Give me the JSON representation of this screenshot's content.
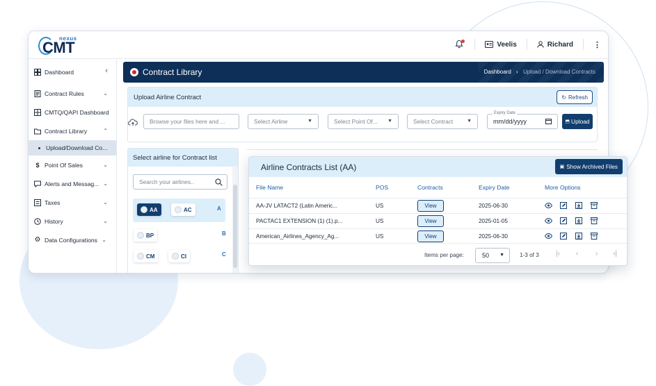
{
  "app": {
    "logo_main": "CMT",
    "logo_sub": "nexus"
  },
  "topbar": {
    "org": "Veelis",
    "user": "Richard"
  },
  "sidebar": {
    "items": [
      {
        "label": "Dashboard",
        "icon": "dashboard-icon"
      },
      {
        "label": "Contract Rules",
        "icon": "contract-rules-icon"
      },
      {
        "label": "CMTQ/QAPI Dashboard",
        "icon": "grid-icon"
      },
      {
        "label": "Contract Library",
        "icon": "folder-icon"
      },
      {
        "label": "Upload/Download Co...",
        "icon": "bullet"
      },
      {
        "label": "Point Of Sales",
        "icon": "dollar-icon"
      },
      {
        "label": "Alerts and Messag...",
        "icon": "message-icon"
      },
      {
        "label": "Taxes",
        "icon": "tax-icon"
      },
      {
        "label": "History",
        "icon": "history-icon"
      },
      {
        "label": "Data Configurations",
        "icon": "gear-icon"
      }
    ]
  },
  "header": {
    "title": "Contract Library",
    "crumb_home": "Dashboard",
    "crumb_sep": "›",
    "crumb_current": "Upload / Download Contracts"
  },
  "upload": {
    "title": "Upload Airline Contract",
    "refresh_label": "Refresh",
    "browse_placeholder": "Browse your files here and ...",
    "airline_placeholder": "Select Airline",
    "pos_placeholder": "Select Point Of...",
    "contract_placeholder": "Select Contract",
    "expiry_label": "Expiry Date",
    "expiry_value": "mm/dd/yyyy",
    "upload_label": "Upload"
  },
  "airline_panel": {
    "title": "Select airline for Contract list",
    "search_placeholder": "Search your airlines..",
    "groups": [
      {
        "letter": "A",
        "chips": [
          "AA",
          "AC"
        ]
      },
      {
        "letter": "B",
        "chips": [
          "BP"
        ]
      },
      {
        "letter": "C",
        "chips": [
          "CM",
          "CI"
        ]
      }
    ]
  },
  "contracts": {
    "title": "Airline Contracts List (AA)",
    "show_archived": "Show Archived Files",
    "columns": [
      "File Name",
      "POS",
      "Contracts",
      "Expiry Date",
      "More Options"
    ],
    "rows": [
      {
        "file": "AA-JV LATACT2 (Latin Americ...",
        "pos": "US",
        "contract": "View",
        "expiry": "2025-06-30"
      },
      {
        "file": "PACTAC1 EXTENSION (1) (1).p...",
        "pos": "US",
        "contract": "View",
        "expiry": "2025-01-05"
      },
      {
        "file": "American_Airlines_Agency_Ag...",
        "pos": "US",
        "contract": "View",
        "expiry": "2025-06-30"
      }
    ],
    "items_per_page_label": "Items per page:",
    "items_per_page": "50",
    "range": "1-3 of 3"
  },
  "colors": {
    "navy": "#0d2f58",
    "accent": "#123e6e",
    "light_blue": "#ddeefb",
    "link_blue": "#1e5fa8"
  }
}
